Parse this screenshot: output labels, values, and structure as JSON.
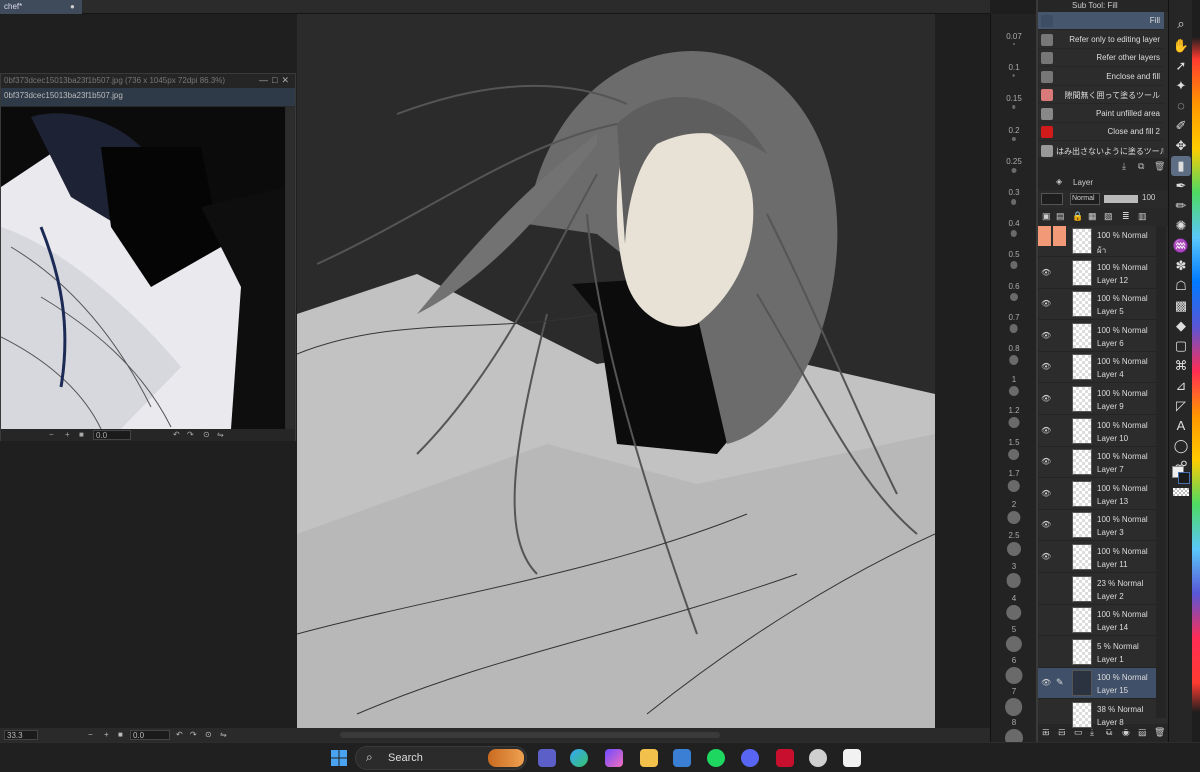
{
  "document": {
    "tab_name": "chef*"
  },
  "reference_window": {
    "title": "0bf373dcec15013ba23f1b507.jpg (736 x 1045px 72dpi 86.3%)",
    "tab": "0bf373dcec15013ba23f1b507.jpg",
    "status": {
      "rotation": "0.0"
    }
  },
  "status_bar": {
    "zoom": "33.3",
    "rotation": "0.0"
  },
  "brush_sizes": [
    "0.07",
    "0.1",
    "0.15",
    "0.2",
    "0.25",
    "0.3",
    "0.4",
    "0.5",
    "0.6",
    "0.7",
    "0.8",
    "1",
    "1.2",
    "1.5",
    "1.7",
    "2",
    "2.5",
    "3",
    "4",
    "5",
    "6",
    "7",
    "8"
  ],
  "sub_tool": {
    "header": "Sub Tool: Fill",
    "items": [
      {
        "label": "Fill",
        "color": "#3d4d63"
      },
      {
        "label": "Refer only to editing layer",
        "color": "#777"
      },
      {
        "label": "Refer other layers",
        "color": "#777"
      },
      {
        "label": "Enclose and fill",
        "color": "#777"
      },
      {
        "label": "隙間無く囲って塗るツール",
        "color": "#d87a7a"
      },
      {
        "label": "Paint unfilled area",
        "color": "#888"
      },
      {
        "label": "Close and fill 2",
        "color": "#d11a1a"
      },
      {
        "label": "はみ出さないように塗るツール",
        "color": "#999"
      }
    ]
  },
  "layer_panel": {
    "header": "Layer",
    "blend_mode": "Normal",
    "opacity": "100",
    "layers": [
      {
        "mode": "100 % Normal",
        "name": "ผ้า",
        "visible": false
      },
      {
        "mode": "100 % Normal",
        "name": "Layer 12",
        "visible": true
      },
      {
        "mode": "100 % Normal",
        "name": "Layer 5",
        "visible": true
      },
      {
        "mode": "100 % Normal",
        "name": "Layer 6",
        "visible": true
      },
      {
        "mode": "100 % Normal",
        "name": "Layer 4",
        "visible": true
      },
      {
        "mode": "100 % Normal",
        "name": "Layer 9",
        "visible": true
      },
      {
        "mode": "100 % Normal",
        "name": "Layer 10",
        "visible": true
      },
      {
        "mode": "100 % Normal",
        "name": "Layer 7",
        "visible": true
      },
      {
        "mode": "100 % Normal",
        "name": "Layer 13",
        "visible": true
      },
      {
        "mode": "100 % Normal",
        "name": "Layer 3",
        "visible": true
      },
      {
        "mode": "100 % Normal",
        "name": "Layer 11",
        "visible": true
      },
      {
        "mode": "23 % Normal",
        "name": "Layer 2",
        "visible": false
      },
      {
        "mode": "100 % Normal",
        "name": "Layer 14",
        "visible": false
      },
      {
        "mode": "5 % Normal",
        "name": "Layer 1",
        "visible": false
      },
      {
        "mode": "100 % Normal",
        "name": "Layer 15",
        "visible": true,
        "selected": true
      },
      {
        "mode": "38 % Normal",
        "name": "Layer 8",
        "visible": false
      }
    ]
  },
  "taskbar": {
    "search_placeholder": "Search"
  }
}
